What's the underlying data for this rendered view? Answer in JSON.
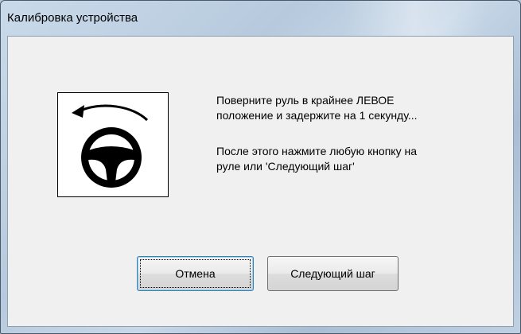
{
  "window": {
    "title": "Калибровка устройства"
  },
  "icon": "steering-wheel-left-turn-icon",
  "message": {
    "line1": "Поверните руль в крайнее ЛЕВОЕ",
    "line2": "положение и задержите на 1 секунду...",
    "line3": "После этого нажмите любую кнопку на",
    "line4": "руле или 'Следующий шаг'"
  },
  "buttons": {
    "cancel_label": "Отмена",
    "next_label": "Следующий шаг"
  }
}
